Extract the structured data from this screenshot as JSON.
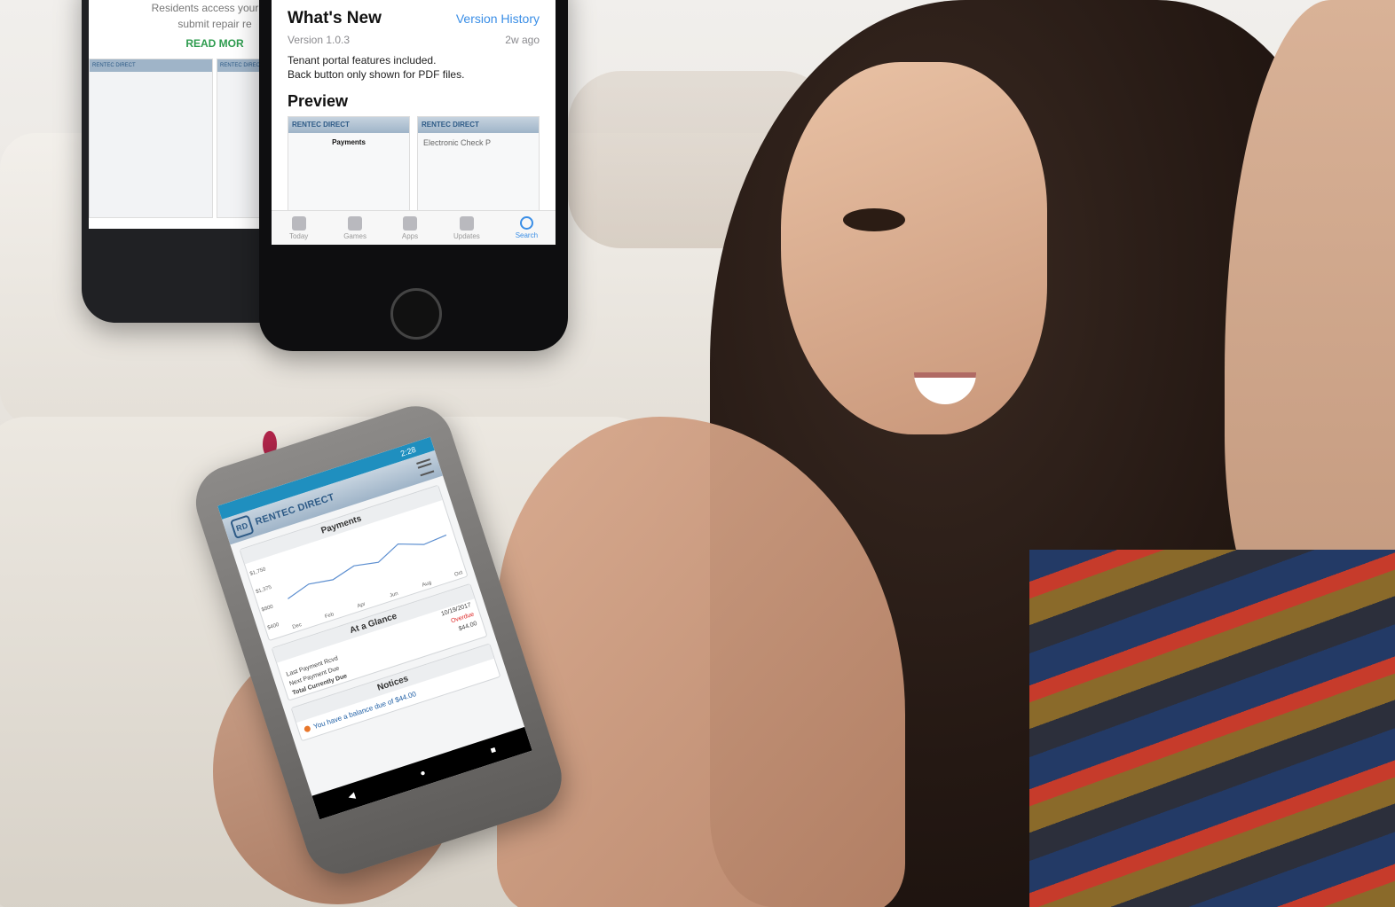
{
  "top_left_phone": {
    "text_line1": "Residents access your acc",
    "text_line2": "submit repair re",
    "read_more": "READ MOR",
    "mini_headers": [
      "RENTEC DIRECT",
      "RENTEC DIRECT"
    ]
  },
  "iphone": {
    "whats_new": "What's New",
    "version_history": "Version History",
    "version": "Version 1.0.3",
    "ago": "2w ago",
    "note_line1": "Tenant portal features included.",
    "note_line2": "Back button only shown for PDF files.",
    "preview": "Preview",
    "thumb1_brand": "RENTEC DIRECT",
    "thumb1_title": "Payments",
    "thumb2_brand": "RENTEC DIRECT",
    "thumb2_title": "Electronic Check P",
    "tabs": [
      "Today",
      "Games",
      "Apps",
      "Updates",
      "Search"
    ],
    "active_tab": "Search"
  },
  "android_phone": {
    "status_time": "2:28",
    "brand": "RENTEC DIRECT",
    "logo_text": "RD",
    "payments_title": "Payments",
    "chart_data": {
      "type": "line",
      "categories": [
        "Dec",
        "Feb",
        "Apr",
        "Jun",
        "Aug",
        "Oct"
      ],
      "yticks": [
        "$1,750",
        "$1,375",
        "$800",
        "$400"
      ],
      "values": [
        820,
        1000,
        920,
        1080,
        980,
        1250,
        1050,
        1100
      ],
      "ylim": [
        400,
        1750
      ]
    },
    "glance_title": "At a Glance",
    "glance_date": "10/19/2017",
    "last_payment_label": "Last Payment Rcvd",
    "next_payment_label": "Next Payment Due",
    "next_payment_value": "Overdue",
    "total_due_label": "Total Currently Due",
    "total_due_value": "$44.00",
    "notices_title": "Notices",
    "notice_text": "You have a balance due of $44.00"
  },
  "colors": {
    "accent_blue": "#3a8ee6",
    "brand_blue": "#2d5a86",
    "read_more_green": "#2e9c4f",
    "overdue_red": "#dd2222"
  }
}
